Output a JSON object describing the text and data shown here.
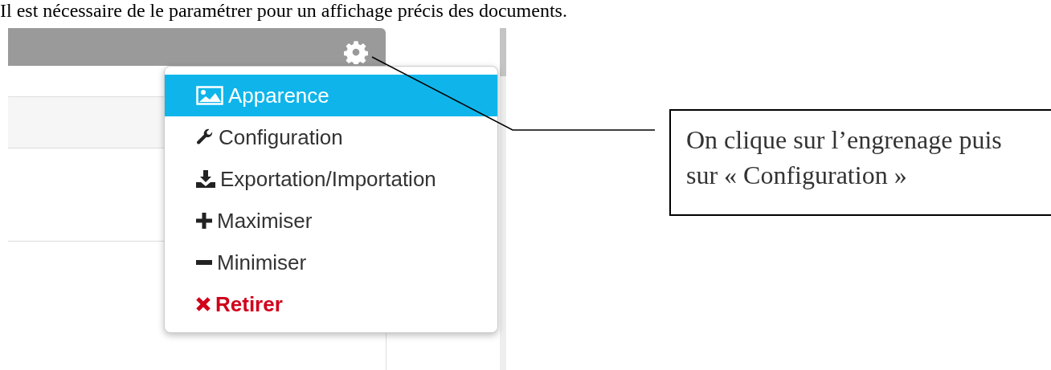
{
  "intro_text": "Il est nécessaire de le paramétrer pour un affichage précis des documents.",
  "menu": [
    {
      "label": "Apparence",
      "kind": "image",
      "selected": true
    },
    {
      "label": "Configuration",
      "kind": "wrench",
      "selected": false
    },
    {
      "label": "Exportation/Importation",
      "kind": "download",
      "selected": false
    },
    {
      "label": "Maximiser",
      "kind": "plus",
      "selected": false
    },
    {
      "label": "Minimiser",
      "kind": "minus",
      "selected": false
    },
    {
      "label": "Retirer",
      "kind": "remove",
      "selected": false
    }
  ],
  "callout": "On clique sur l’engrenage puis sur « Configuration »"
}
